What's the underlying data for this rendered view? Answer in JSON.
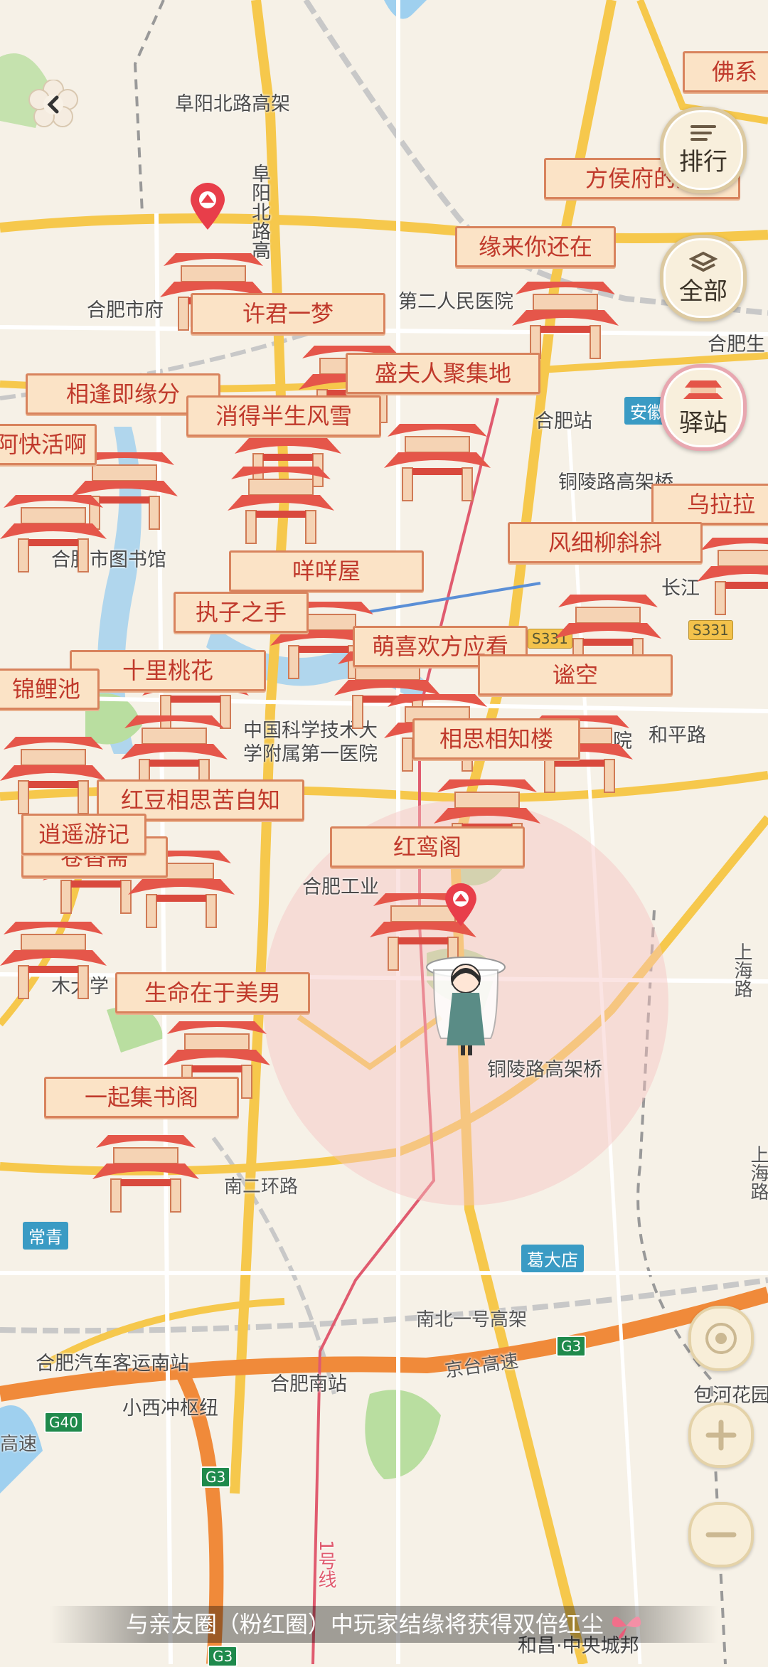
{
  "map": {
    "places": {
      "fuyang_north": "阜阳北路高架",
      "fuyang_north_vertical": "阜阳北路高",
      "hefei_city": "合肥市府",
      "second_hospital": "第二人民医院",
      "hefei_station": "合肥站",
      "tongling_elevated_top": "铜陵路高架桥",
      "library": "合肥市图书馆",
      "changjiang": "长江",
      "heping_road": "和平路",
      "ustc_hospital_1": "中国科学技术大",
      "ustc_hospital_2": "学附属第一医院",
      "hefei_industry": "合肥工业",
      "tech_university": "木大学",
      "tongling_elevated": "铜陵路高架桥",
      "south_ring": "南二环路",
      "changqing": "常青",
      "gedadian": "葛大店",
      "nanbei_elevated": "南北一号高架",
      "bus_station": "合肥汽车客运南站",
      "hefei_south": "合肥南站",
      "jingtai": "京台高速",
      "xiaoxichong": "小西冲枢纽",
      "baohe_garden": "包河花园",
      "shanghai_road": "上海路",
      "shanghai_road2": "上海路",
      "line1": "1号线",
      "hechang": "和昌·中央城邦",
      "hefei_eco": "合肥生",
      "anhui": "安徽",
      "hospital_small": "院",
      "gaosu": "高速"
    },
    "highway_badges": {
      "s331": "S331",
      "s331b": "S331",
      "g3": "G3",
      "g40": "G40",
      "g3b": "G3",
      "g3c": "G3"
    },
    "colors": {
      "expressway": "#f6c84c",
      "highway": "#f08a3a",
      "rail": "#bdbdbd",
      "metro": "#e05b6f",
      "water": "#9fd0ef",
      "green": "#b9dea0",
      "range_circle": "#f7c4c0"
    }
  },
  "stations": [
    {
      "name": "佛系"
    },
    {
      "name": "方侯府的后"
    },
    {
      "name": "缘来你还在"
    },
    {
      "name": "许君一梦"
    },
    {
      "name": "盛夫人聚集地"
    },
    {
      "name": "相逢即缘分"
    },
    {
      "name": "消得半生风雪"
    },
    {
      "name": "阿快活啊"
    },
    {
      "name": "乌拉拉"
    },
    {
      "name": "风细柳斜斜"
    },
    {
      "name": "咩咩屋"
    },
    {
      "name": "执子之手"
    },
    {
      "name": "萌喜欢方应看"
    },
    {
      "name": "十里桃花"
    },
    {
      "name": "谧空"
    },
    {
      "name": "锦鲤池"
    },
    {
      "name": "相思相知楼"
    },
    {
      "name": "红豆相思苦自知"
    },
    {
      "name": "卷香斋"
    },
    {
      "name": "红鸾阁"
    },
    {
      "name": "生命在于美男"
    },
    {
      "name": "一起集书阁"
    },
    {
      "name": "逍遥游记"
    }
  ],
  "buttons": {
    "back": {
      "icon": "flower-back-icon"
    },
    "rank": {
      "label": "排行",
      "icon": "list-icon"
    },
    "all": {
      "label": "全部",
      "icon": "layers-icon"
    },
    "station": {
      "label": "驿站",
      "icon": "pavilion-icon"
    },
    "locate": {
      "icon": "locate-icon"
    },
    "zoom_in": {
      "icon": "plus-icon"
    },
    "zoom_out": {
      "icon": "minus-icon"
    }
  },
  "notice": {
    "text": "与亲友圈（粉红圈）中玩家结缘将获得双倍红尘",
    "icon": "butterfly-icon"
  }
}
